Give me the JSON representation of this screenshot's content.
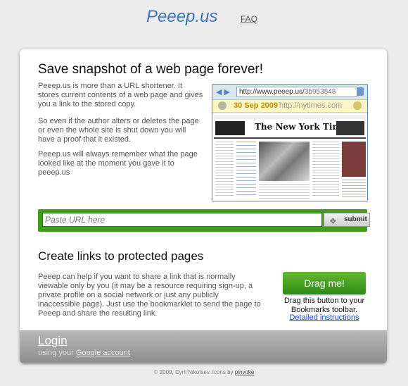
{
  "header": {
    "logo": "Peeep.us",
    "faq": "FAQ"
  },
  "main": {
    "title": "Save snapshot of a web page forever!",
    "paragraphs": [
      "Peeep.us is more than a URL shortener. It stores current contents of a web page and gives you a link to the stored copy.",
      "So even if the author alters or deletes the page or even the whole site is shut down you will have a proof that it existed.",
      "Peeep.us will always remember what the page looked like at the moment you gave it to peeep.us"
    ],
    "preview": {
      "url_prefix": "http://www.peeep.us/",
      "url_hash": "3b953848",
      "date": "30 Sep 2009",
      "original_url": "http://nytimes.com",
      "newspaper": "The New York Times"
    },
    "url_input": {
      "placeholder": "Paste URL here"
    },
    "submit_label": "submit"
  },
  "protected": {
    "title": "Create links to protected pages",
    "description": "Peeep can help if you want to share a link that is normally viewable only by you (it may be a resource requiring sign-up, a private profile on a social network or just any publicly inaccessible page). Just use the bookmarklet to send the page to Peeep and share the resulting link.",
    "drag_button": "Drag me!",
    "drag_desc": "Drag this button to your Bookmarks toolbar.",
    "instructions_link": "Detailed instructions"
  },
  "login": {
    "label": "Login",
    "sub_prefix": "using your",
    "google_link": "Google account"
  },
  "footer": {
    "copyright": "© 2009, Cyril Nikolaev. Icons by",
    "icons_link": "pinvoke"
  },
  "colors": {
    "accent": "#3a74c4",
    "green": "#3f9c1d",
    "link": "#1a3fc7"
  }
}
